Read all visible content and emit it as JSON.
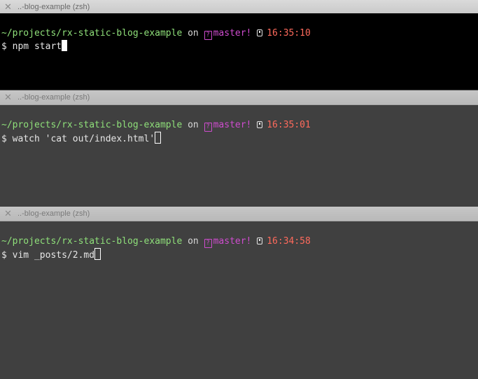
{
  "panes": [
    {
      "tab_title": "..-blog-example (zsh)",
      "prompt": {
        "path": "~/projects/rx-static-blog-example",
        "on": "on",
        "branch_icon": "?",
        "branch": "master!",
        "time": "16:35:10"
      },
      "command_prefix": "$ ",
      "command": "npm start"
    },
    {
      "tab_title": "..-blog-example (zsh)",
      "prompt": {
        "path": "~/projects/rx-static-blog-example",
        "on": "on",
        "branch_icon": "?",
        "branch": "master!",
        "time": "16:35:01"
      },
      "command_prefix": "$ ",
      "command": "watch 'cat out/index.html'"
    },
    {
      "tab_title": "..-blog-example (zsh)",
      "prompt": {
        "path": "~/projects/rx-static-blog-example",
        "on": "on",
        "branch_icon": "?",
        "branch": "master!",
        "time": "16:34:58"
      },
      "command_prefix": "$ ",
      "command": "vim _posts/2.md"
    }
  ]
}
